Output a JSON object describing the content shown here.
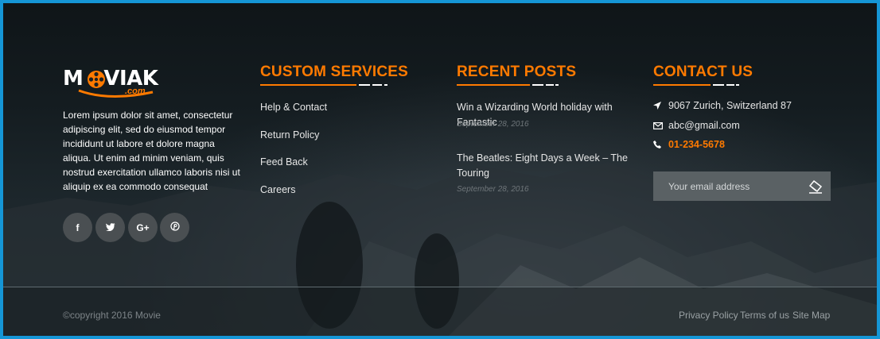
{
  "colors": {
    "accent": "#ff7a00",
    "frame": "#1596d6",
    "social_bg": "#4a4f52",
    "input_bg": "#5a6164"
  },
  "brand": {
    "name": "MOVIAK",
    "suffix": ".com"
  },
  "about": {
    "text": "Lorem ipsum dolor sit amet, consectetur adipiscing elit, sed do eiusmod tempor incididunt ut labore et dolore magna aliqua. Ut enim ad minim veniam, quis nostrud exercitation ullamco laboris nisi ut aliquip ex ea commodo consequat"
  },
  "social": [
    {
      "icon": "facebook-icon",
      "glyph": "f"
    },
    {
      "icon": "twitter-icon",
      "glyph": "t"
    },
    {
      "icon": "google-plus-icon",
      "glyph": "G+"
    },
    {
      "icon": "pinterest-icon",
      "glyph": "p"
    }
  ],
  "services": {
    "heading": "CUSTOM SERVICES",
    "links": [
      "Help & Contact",
      "Return Policy",
      "Feed Back",
      "Careers"
    ]
  },
  "recent_posts": {
    "heading": "RECENT POSTS",
    "posts": [
      {
        "title": "Win a Wizarding World holiday with Fantastic",
        "date": "September 28, 2016"
      },
      {
        "title": "The Beatles: Eight Days a Week – The Touring",
        "date": "September 28, 2016"
      }
    ]
  },
  "contact": {
    "heading": "CONTACT US",
    "address": "9067 Zurich, Switzerland 87",
    "email": "abc@gmail.com",
    "phone": "01-234-5678",
    "icons": [
      "location-arrow-icon",
      "envelope-icon",
      "phone-icon"
    ],
    "subscribe_placeholder": "Your email address",
    "subscribe_icon": "eraser-send-icon"
  },
  "footer": {
    "copyright": "©copyright 2016 Movie",
    "links": [
      "Privacy Policy",
      "Terms of us",
      "Site Map"
    ]
  }
}
